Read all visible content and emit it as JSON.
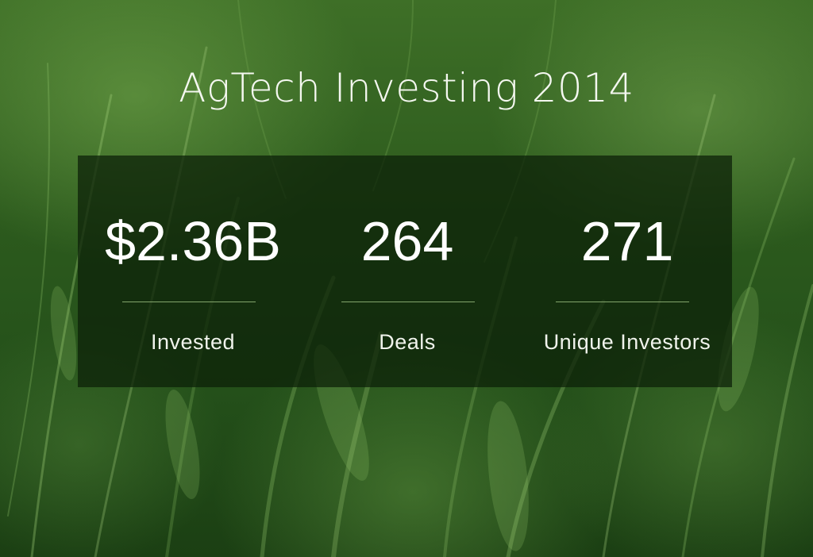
{
  "title": "AgTech Investing 2014",
  "stats": [
    {
      "value": "$2.36B",
      "label": "Invested"
    },
    {
      "value": "264",
      "label": "Deals"
    },
    {
      "value": "271",
      "label": "Unique Investors"
    }
  ],
  "colors": {
    "background_green": "#2c5a1d",
    "panel_overlay": "#0c2008",
    "text": "#ffffff",
    "divider": "#aacd8c"
  }
}
